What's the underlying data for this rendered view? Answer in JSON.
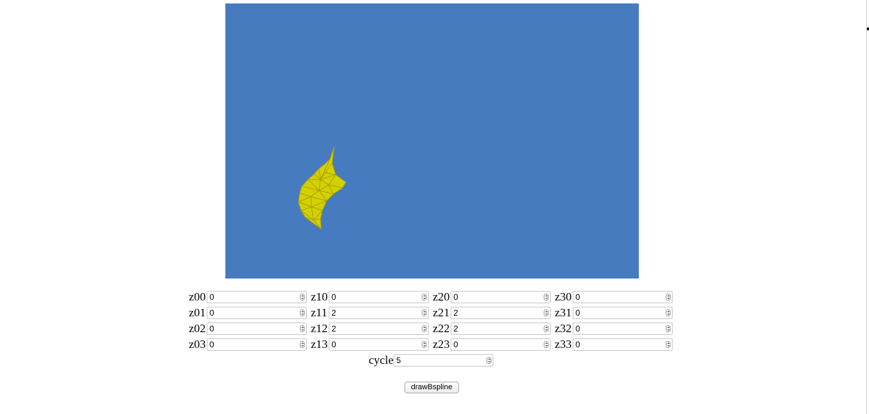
{
  "canvas": {
    "background_color": "#477bc0",
    "surface_color": "#d4d100",
    "mesh_color": "#a8a000"
  },
  "controls": {
    "rows": [
      [
        {
          "label": "z00",
          "value": "0"
        },
        {
          "label": "z10",
          "value": "0"
        },
        {
          "label": "z20",
          "value": "0"
        },
        {
          "label": "z30",
          "value": "0"
        }
      ],
      [
        {
          "label": "z01",
          "value": "0"
        },
        {
          "label": "z11",
          "value": "2"
        },
        {
          "label": "z21",
          "value": "2"
        },
        {
          "label": "z31",
          "value": "0"
        }
      ],
      [
        {
          "label": "z02",
          "value": "0"
        },
        {
          "label": "z12",
          "value": "2"
        },
        {
          "label": "z22",
          "value": "2"
        },
        {
          "label": "z32",
          "value": "0"
        }
      ],
      [
        {
          "label": "z03",
          "value": "0"
        },
        {
          "label": "z13",
          "value": "0"
        },
        {
          "label": "z23",
          "value": "0"
        },
        {
          "label": "z33",
          "value": "0"
        }
      ]
    ],
    "cycle": {
      "label": "cycle",
      "value": "5"
    }
  },
  "button": {
    "label": "drawBspline"
  }
}
